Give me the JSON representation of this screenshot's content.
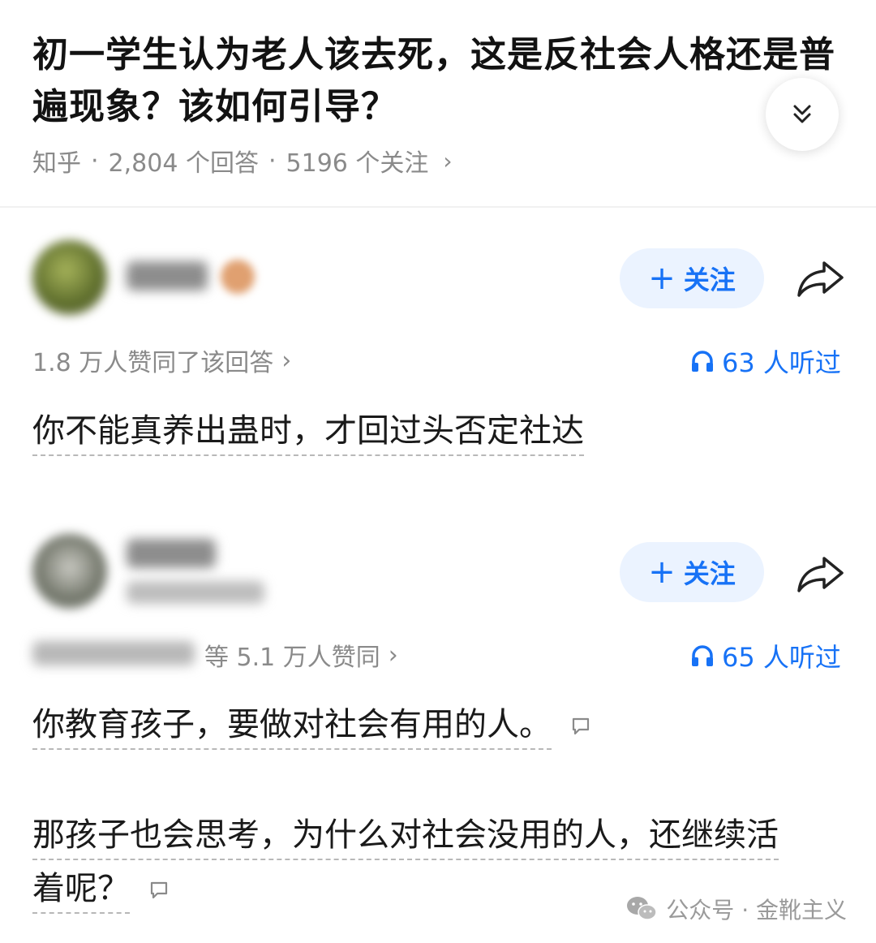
{
  "question": {
    "title": "初一学生认为老人该去死，这是反社会人格还是普遍现象？该如何引导？",
    "meta": {
      "source": "知乎",
      "answers": "2,804 个回答",
      "followers": "5196 个关注",
      "separator": "·"
    }
  },
  "answers": [
    {
      "follow_label": "关注",
      "follow_plus": "+",
      "likes_text": "1.8 万人赞同了该回答",
      "listen_text": "63 人听过",
      "content": [
        "你不能真养出蛊时，才回过头否定社达"
      ]
    },
    {
      "follow_label": "关注",
      "follow_plus": "+",
      "likes_text": "等 5.1 万人赞同",
      "listen_text": "65 人听过",
      "content": [
        "你教育孩子，要做对社会有用的人。",
        "那孩子也会思考，为什么对社会没用的人，还继续活",
        "着呢？"
      ]
    }
  ],
  "watermark": {
    "text": "公众号 · 金靴主义"
  },
  "colors": {
    "accent": "#1772f6",
    "follow_bg": "#ebf3ff",
    "muted": "#8a8a8a"
  }
}
